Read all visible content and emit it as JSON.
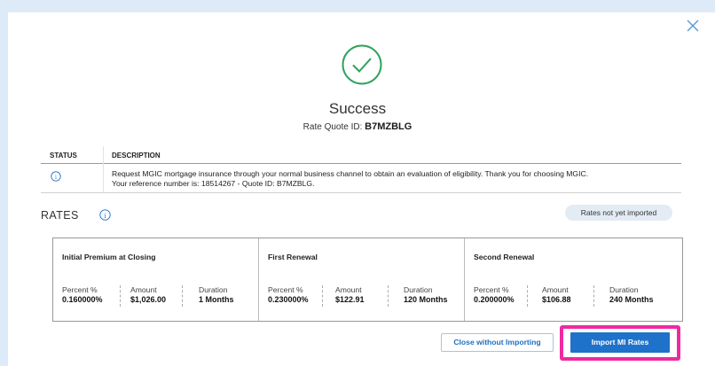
{
  "modal": {
    "title": "Success",
    "quote_label": "Rate Quote ID:",
    "quote_id": "B7MZBLG",
    "close_icon": "close-icon",
    "success_icon": "check-circle-icon",
    "accent_color": "#2ea35a"
  },
  "status_table": {
    "headers": [
      "STATUS",
      "DESCRIPTION"
    ],
    "row": {
      "status_icon": "info-icon",
      "description_line1": "Request MGIC mortgage insurance through your normal business channel to obtain an evaluation of eligibility. Thank you for choosing MGIC.",
      "description_line2": "Your reference number is: 18514267 - Quote ID: B7MZBLG."
    }
  },
  "rates": {
    "label": "RATES",
    "info_icon": "info-icon",
    "badge": "Rates not yet imported",
    "columns": [
      {
        "title": "Initial Premium at Closing",
        "percent_label": "Percent %",
        "percent": "0.160000%",
        "amount_label": "Amount",
        "amount": "$1,026.00",
        "duration_label": "Duration",
        "duration": "1 Months"
      },
      {
        "title": "First Renewal",
        "percent_label": "Percent %",
        "percent": "0.230000%",
        "amount_label": "Amount",
        "amount": "$122.91",
        "duration_label": "Duration",
        "duration": "120 Months"
      },
      {
        "title": "Second Renewal",
        "percent_label": "Percent %",
        "percent": "0.200000%",
        "amount_label": "Amount",
        "amount": "$106.88",
        "duration_label": "Duration",
        "duration": "240 Months"
      }
    ]
  },
  "footer": {
    "close_without_importing": "Close without Importing",
    "import_mi_rates": "Import MI Rates",
    "primary_color": "#1f72c9",
    "highlight_color": "#ee2aa2"
  }
}
